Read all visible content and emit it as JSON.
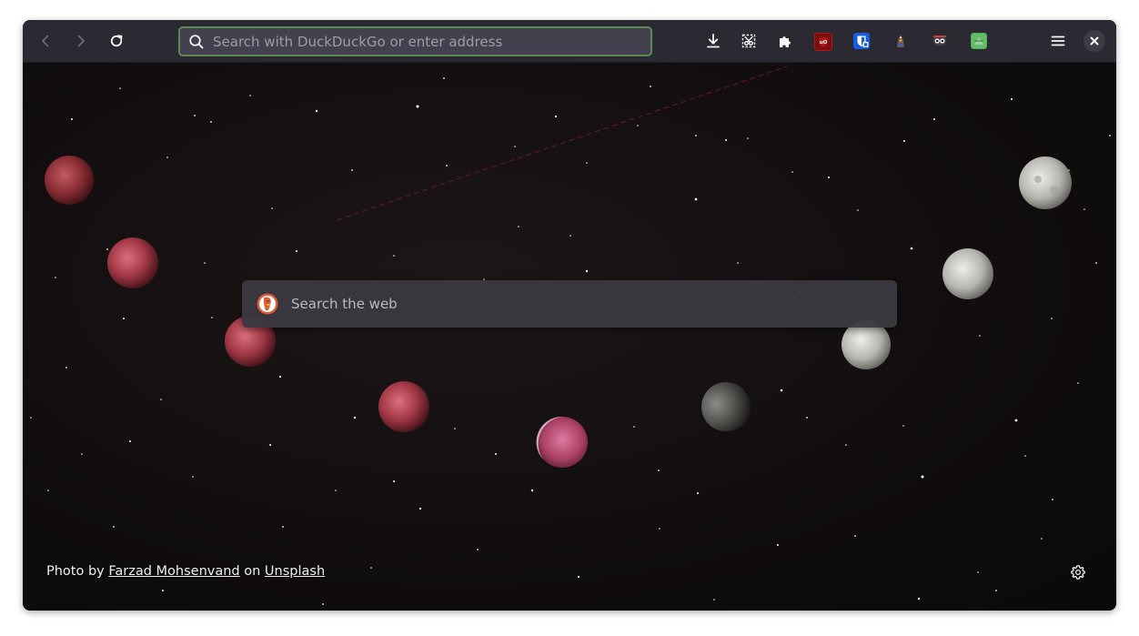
{
  "browser": {
    "urlbar": {
      "placeholder": "Search with DuckDuckGo or enter address",
      "value": ""
    },
    "nav": {
      "back_icon": "chevron-left-icon",
      "forward_icon": "chevron-right-icon",
      "reload_icon": "reload-icon"
    },
    "toolbar_icons": [
      "download-icon",
      "screenshot-icon",
      "extensions-icon",
      "ublock-origin-icon",
      "bitwarden-icon",
      "privacy-badger-icon",
      "tampermonkey-icon",
      "green-extension-icon",
      "menu-icon",
      "close-icon"
    ],
    "colors": {
      "toolbar": "#2b2a33",
      "urlbar_border": "#5b8a53",
      "urlbar_bg": "#42414d"
    }
  },
  "newtab": {
    "search": {
      "placeholder": "Search the web",
      "engine_icon": "duckduckgo-icon"
    },
    "credit": {
      "prefix": "Photo by",
      "author": "Farzad Mohsenvand",
      "middle": "on",
      "site": "Unsplash"
    },
    "settings_icon": "gear-icon"
  }
}
